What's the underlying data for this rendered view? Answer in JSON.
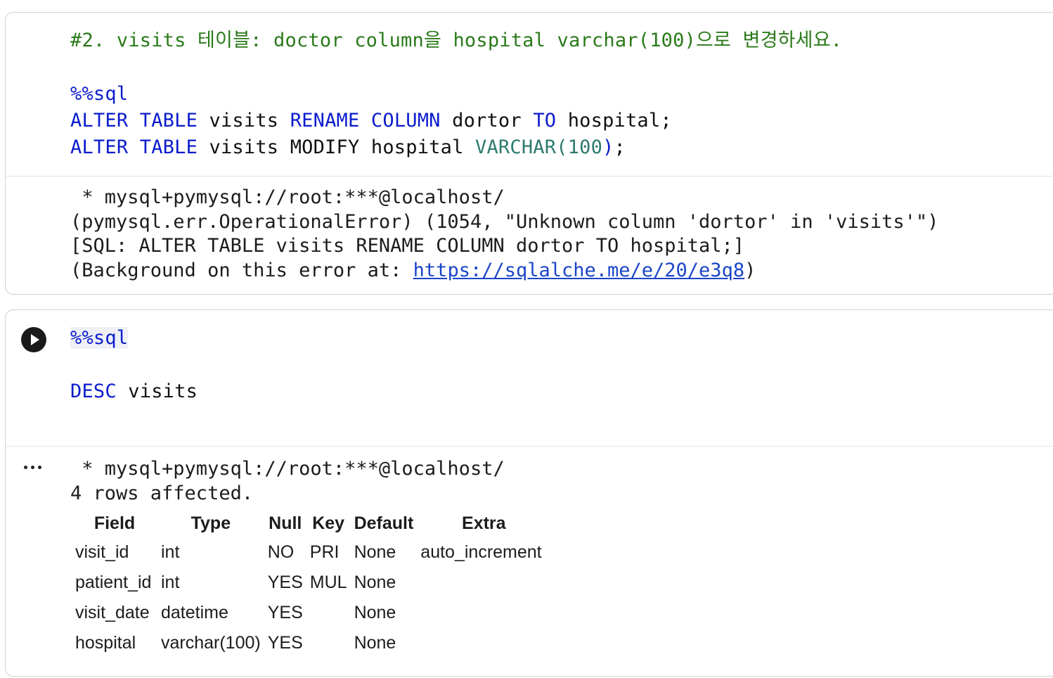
{
  "cell1": {
    "comment": "#2. visits 테이블: doctor column을 hospital varchar(100)으로 변경하세요.",
    "magic": "%%sql",
    "line1": {
      "kw_alter": "ALTER",
      "kw_table": "TABLE",
      "tbl": "visits",
      "kw_rename": "RENAME",
      "kw_column": "COLUMN",
      "old_col": "dortor",
      "kw_to": "TO",
      "new_col": "hospital;"
    },
    "line2": {
      "kw_alter": "ALTER",
      "kw_table": "TABLE",
      "rest": "visits MODIFY hospital",
      "type_name": "VARCHAR(",
      "type_num": "100",
      "type_close": ")",
      "end": ";"
    },
    "output": {
      "conn": " * mysql+pymysql://root:***@localhost/",
      "error": "(pymysql.err.OperationalError) (1054, \"Unknown column 'dortor' in 'visits'\")",
      "sql": "[SQL: ALTER TABLE visits RENAME COLUMN dortor TO hospital;]",
      "bg_prefix": "(Background on this error at: ",
      "bg_link": "https://sqlalche.me/e/20/e3q8",
      "bg_suffix": ")"
    }
  },
  "cell2": {
    "magic": "%%sql",
    "kw_desc": "DESC",
    "tbl": "visits",
    "output": {
      "conn": " * mysql+pymysql://root:***@localhost/",
      "rows": "4 rows affected.",
      "headers": [
        "Field",
        "Type",
        "Null",
        "Key",
        "Default",
        "Extra"
      ],
      "data": [
        [
          "visit_id",
          "int",
          "NO",
          "PRI",
          "None",
          "auto_increment"
        ],
        [
          "patient_id",
          "int",
          "YES",
          "MUL",
          "None",
          ""
        ],
        [
          "visit_date",
          "datetime",
          "YES",
          "",
          "None",
          ""
        ],
        [
          "hospital",
          "varchar(100)",
          "YES",
          "",
          "None",
          ""
        ]
      ]
    }
  },
  "colors": {
    "keyword": "#0b1ccc",
    "comment": "#2a7a1a",
    "type": "#2e7a6f",
    "link": "#1a44c8"
  }
}
